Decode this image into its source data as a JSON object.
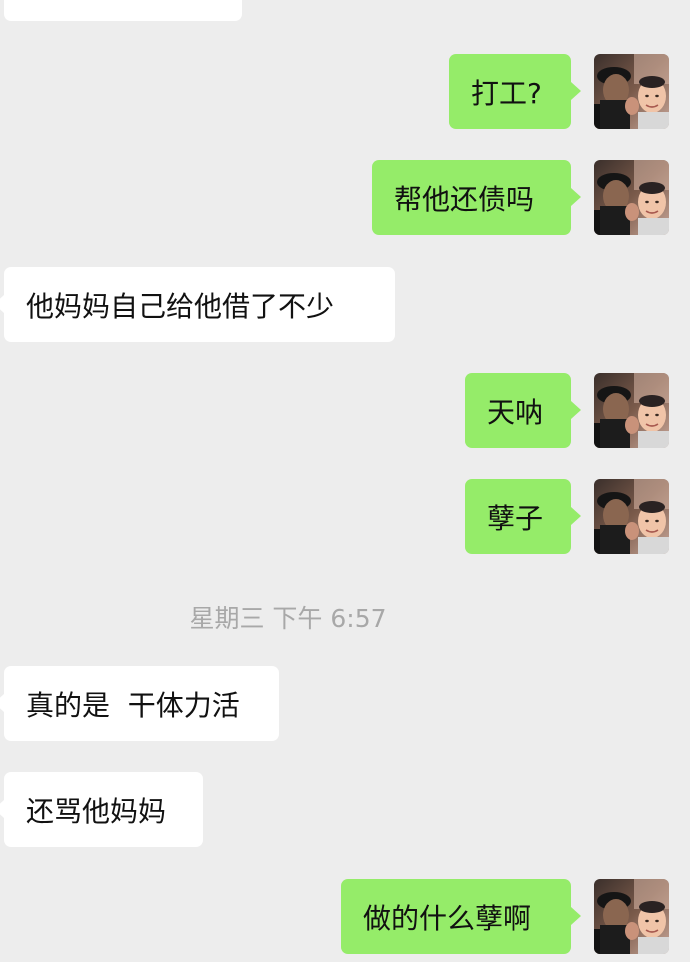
{
  "messages": [
    {
      "side": "in",
      "text": ""
    },
    {
      "side": "out",
      "text": "打工?"
    },
    {
      "side": "out",
      "text": "帮他还债吗"
    },
    {
      "side": "in",
      "text": "他妈妈自己给他借了不少"
    },
    {
      "side": "out",
      "text": "天呐"
    },
    {
      "side": "out",
      "text": "孽子"
    },
    {
      "side": "in",
      "text": "真的是  干体力活"
    },
    {
      "side": "in",
      "text": "还骂他妈妈"
    },
    {
      "side": "out",
      "text": "做的什么孽啊"
    }
  ],
  "timestamp": "星期三 下午 6:57",
  "avatar": {
    "icon": "user-avatar-photo-icon"
  },
  "colors": {
    "background": "#ededed",
    "incoming_bubble": "#ffffff",
    "outgoing_bubble": "#95ec69",
    "timestamp_text": "#a8a8a8"
  }
}
